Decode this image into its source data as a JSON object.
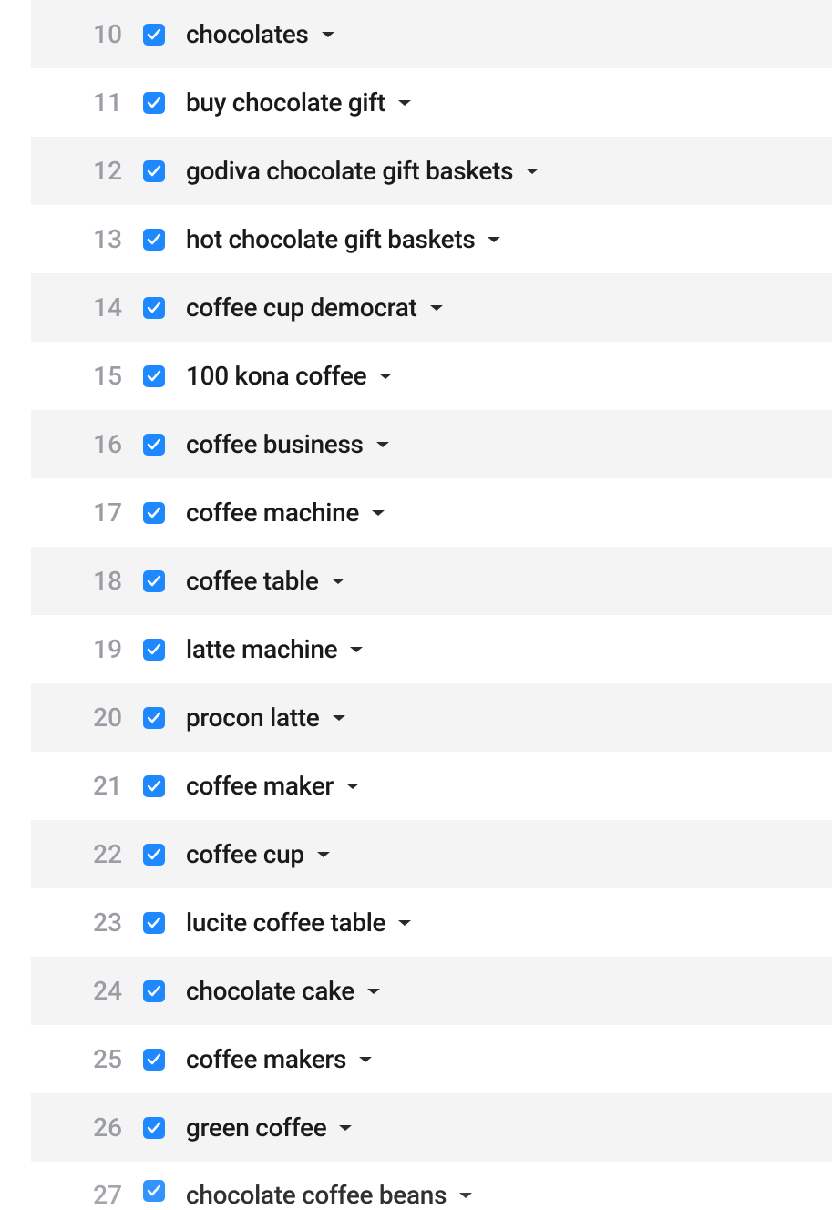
{
  "rows": [
    {
      "num": "10",
      "keyword": "chocolates",
      "checked": true
    },
    {
      "num": "11",
      "keyword": "buy chocolate gift",
      "checked": true
    },
    {
      "num": "12",
      "keyword": "godiva chocolate gift baskets",
      "checked": true
    },
    {
      "num": "13",
      "keyword": "hot chocolate gift baskets",
      "checked": true
    },
    {
      "num": "14",
      "keyword": "coffee cup democrat",
      "checked": true
    },
    {
      "num": "15",
      "keyword": "100 kona coffee",
      "checked": true
    },
    {
      "num": "16",
      "keyword": "coffee business",
      "checked": true
    },
    {
      "num": "17",
      "keyword": "coffee machine",
      "checked": true
    },
    {
      "num": "18",
      "keyword": "coffee table",
      "checked": true
    },
    {
      "num": "19",
      "keyword": "latte machine",
      "checked": true
    },
    {
      "num": "20",
      "keyword": "procon latte",
      "checked": true
    },
    {
      "num": "21",
      "keyword": "coffee maker",
      "checked": true
    },
    {
      "num": "22",
      "keyword": "coffee cup",
      "checked": true
    },
    {
      "num": "23",
      "keyword": "lucite coffee table",
      "checked": true
    },
    {
      "num": "24",
      "keyword": "chocolate cake",
      "checked": true
    },
    {
      "num": "25",
      "keyword": "coffee makers",
      "checked": true
    },
    {
      "num": "26",
      "keyword": "green coffee",
      "checked": true
    },
    {
      "num": "27",
      "keyword": "chocolate coffee beans",
      "checked": true
    }
  ]
}
